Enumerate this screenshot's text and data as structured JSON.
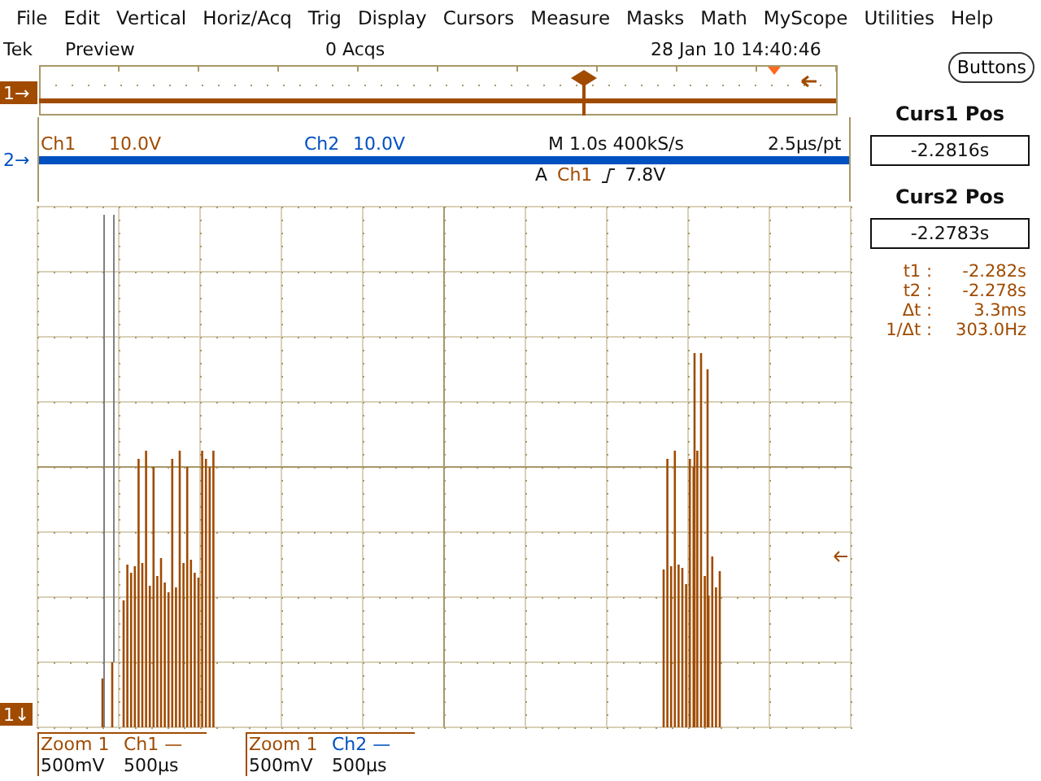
{
  "menu": [
    "File",
    "Edit",
    "Vertical",
    "Horiz/Acq",
    "Trig",
    "Display",
    "Cursors",
    "Measure",
    "Masks",
    "Math",
    "MyScope",
    "Utilities",
    "Help"
  ],
  "status": {
    "brand": "Tek",
    "mode": "Preview",
    "acquisitions": "0 Acqs",
    "datetime": "28 Jan 10 14:40:46"
  },
  "markers": {
    "ch1_overview": "1→",
    "ch2": "2→",
    "zoom_ch1": "1↓"
  },
  "readout": {
    "channels": [
      {
        "name": "Ch1",
        "scale": "10.0V",
        "color": "#a04b00"
      },
      {
        "name": "Ch2",
        "scale": "10.0V",
        "color": "#0050c0"
      }
    ],
    "timebase": "M 1.0s",
    "sample_rate": "400kS/s",
    "resolution": "2.5µs/pt",
    "trigger_mode": "A",
    "trigger_source": "Ch1",
    "trigger_level": "7.8V"
  },
  "right_panel": {
    "button": "Buttons",
    "cursor1": {
      "label": "Curs1 Pos",
      "value": "-2.2816s"
    },
    "cursor2": {
      "label": "Curs2 Pos",
      "value": "-2.2783s"
    },
    "measurements": [
      {
        "label": "t1 :",
        "value": "-2.282s"
      },
      {
        "label": "t2 :",
        "value": "-2.278s"
      },
      {
        "label": "Δt :",
        "value": "3.3ms"
      },
      {
        "label": "1/Δt :",
        "value": "303.0Hz"
      }
    ]
  },
  "zooms": [
    {
      "title": "Zoom 1",
      "channel": "Ch1 —",
      "color": "#a04b00",
      "scale": "500mV",
      "time": "500µs"
    },
    {
      "title": "Zoom 1",
      "channel": "Ch2 —",
      "color": "#0050c0",
      "scale": "500mV",
      "time": "500µs"
    }
  ]
}
